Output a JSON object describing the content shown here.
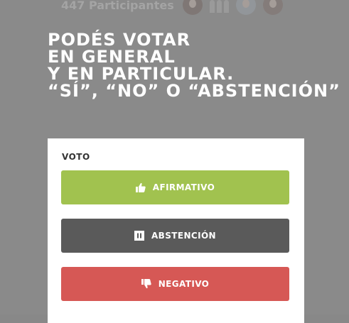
{
  "participants": {
    "count_label": "447 Participantes"
  },
  "headline": {
    "lines": [
      "PODÉS VOTAR",
      "EN GENERAL",
      "Y EN PARTICULAR.",
      "“SÍ”, “NO” O “ABSTENCIÓN”"
    ]
  },
  "vote": {
    "label": "VOTO",
    "options": [
      {
        "label": "AFIRMATIVO",
        "icon": "thumbs-up-icon",
        "color": "#a1c24f"
      },
      {
        "label": "ABSTENCIÓN",
        "icon": "pause-icon",
        "color": "#5a5a5a"
      },
      {
        "label": "NEGATIVO",
        "icon": "thumbs-down-icon",
        "color": "#d65855"
      }
    ]
  },
  "colors": {
    "overlay": "#8a8a8a",
    "card": "#ffffff",
    "headline_text": "#ffffff"
  }
}
